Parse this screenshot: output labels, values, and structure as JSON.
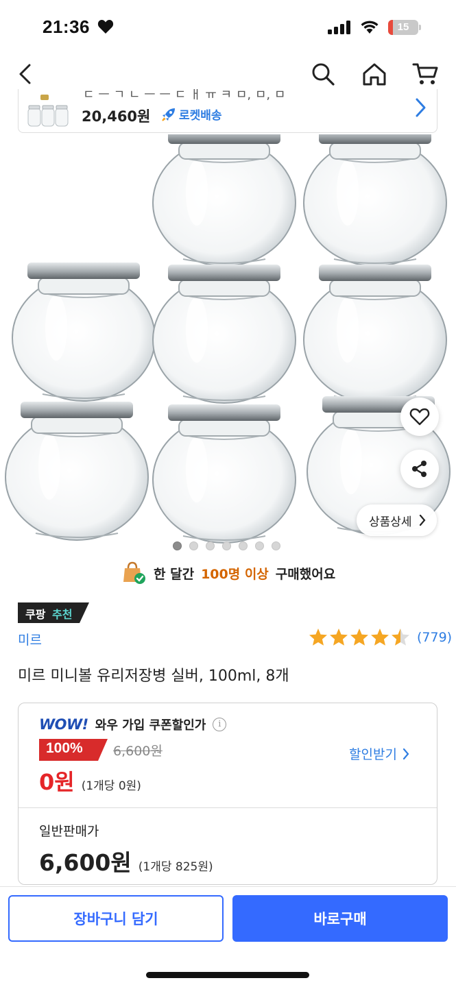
{
  "status_bar": {
    "time": "21:36",
    "battery_level": "15",
    "battery_fraction": 0.15
  },
  "sticky_product": {
    "cut_text": "ㄷ ㅡ ㄱ ㄴ ㅡ ㅡ ㄷ ㅐ ㅠ ㅋ ㅁ, ㅁ, ㅁ",
    "price": "20,460원",
    "delivery": "로켓배송"
  },
  "gallery": {
    "detail_button": "상품상세",
    "total_images": 7,
    "current_index": 0
  },
  "proof": {
    "prefix": "한 달간",
    "count": "100명 이상",
    "suffix": "구매했어요"
  },
  "badge": {
    "part1": "쿠팡",
    "part2": "추천"
  },
  "product": {
    "brand": "미르",
    "rating": 4.5,
    "review_count": "(779)",
    "title": "미르 미니볼 유리저장병 실버, 100ml, 8개"
  },
  "wow_offer": {
    "logo": "WOW!",
    "label": "와우 가입 쿠폰할인가",
    "discount": "100%",
    "original_price": "6,600원",
    "price": "0원",
    "unit_price": "(1개당 0원)",
    "coupon_link": "할인받기"
  },
  "normal_offer": {
    "label": "일반판매가",
    "price": "6,600원",
    "unit_price": "(1개당 825원)"
  },
  "actions": {
    "add_to_cart": "장바구니 담기",
    "buy_now": "바로구매"
  },
  "colors": {
    "accent_blue": "#346aff",
    "link_blue": "#2e7de2",
    "sale_red": "#e52528",
    "star": "#f5a623",
    "wow_navy": "#1f4eb4"
  }
}
